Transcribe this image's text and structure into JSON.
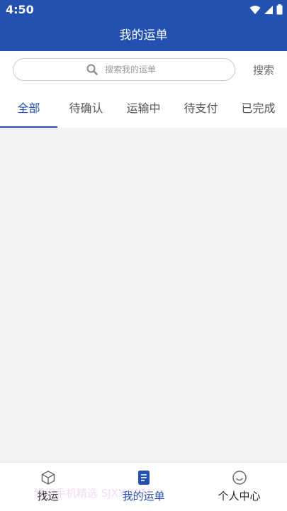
{
  "status": {
    "time": "4:50"
  },
  "header": {
    "title": "我的运单"
  },
  "search": {
    "placeholder": "搜索我的运单",
    "button_label": "搜索"
  },
  "tabs": [
    {
      "label": "全部",
      "active": true
    },
    {
      "label": "待确认",
      "active": false
    },
    {
      "label": "运输中",
      "active": false
    },
    {
      "label": "待支付",
      "active": false
    },
    {
      "label": "已完成",
      "active": false
    }
  ],
  "bottom_nav": [
    {
      "label": "找运",
      "icon": "package-icon",
      "active": false
    },
    {
      "label": "我的运单",
      "icon": "waybill-icon",
      "active": true
    },
    {
      "label": "个人中心",
      "icon": "smiley-icon",
      "active": false
    }
  ],
  "watermark": "常用手机精选 SJXY.COM",
  "colors": {
    "primary": "#2451b0",
    "background": "#f3f3f3"
  }
}
